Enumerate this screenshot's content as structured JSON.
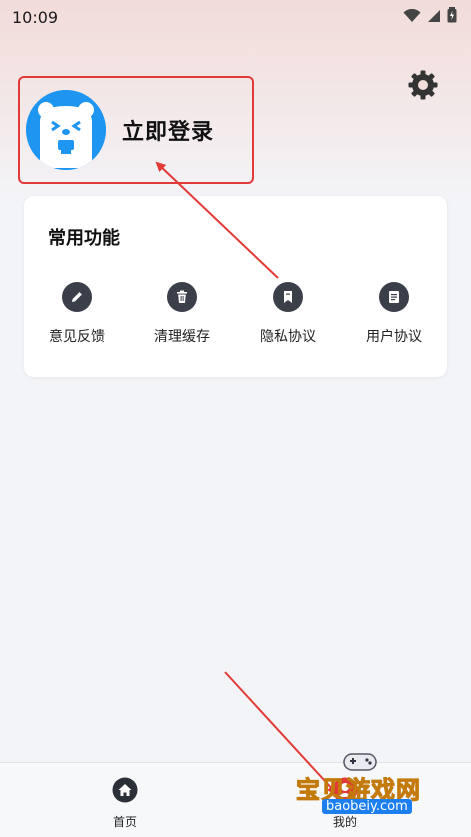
{
  "status_bar": {
    "time": "10:09",
    "icons": [
      "wifi-icon",
      "signal-icon",
      "battery-icon"
    ]
  },
  "profile": {
    "login_label": "立即登录",
    "avatar_icon": "bear-avatar-icon",
    "avatar_color": "#1e95f0"
  },
  "header": {
    "settings_icon": "gear-icon"
  },
  "common_functions": {
    "title": "常用功能",
    "items": [
      {
        "label": "意见反馈",
        "icon": "pencil-icon"
      },
      {
        "label": "清理缓存",
        "icon": "trash-icon"
      },
      {
        "label": "隐私协议",
        "icon": "bookmark-icon"
      },
      {
        "label": "用户协议",
        "icon": "document-icon"
      }
    ]
  },
  "bottom_nav": {
    "items": [
      {
        "label": "首页",
        "icon": "home-icon"
      },
      {
        "label": "我的",
        "icon": "user-icon"
      }
    ]
  },
  "watermark": {
    "text": "宝贝游戏网",
    "url": "baobeiy.com"
  },
  "colors": {
    "highlight_red": "#e23a36",
    "icon_dark": "#3b3f4a",
    "page_bg": "#f3f4f8"
  }
}
